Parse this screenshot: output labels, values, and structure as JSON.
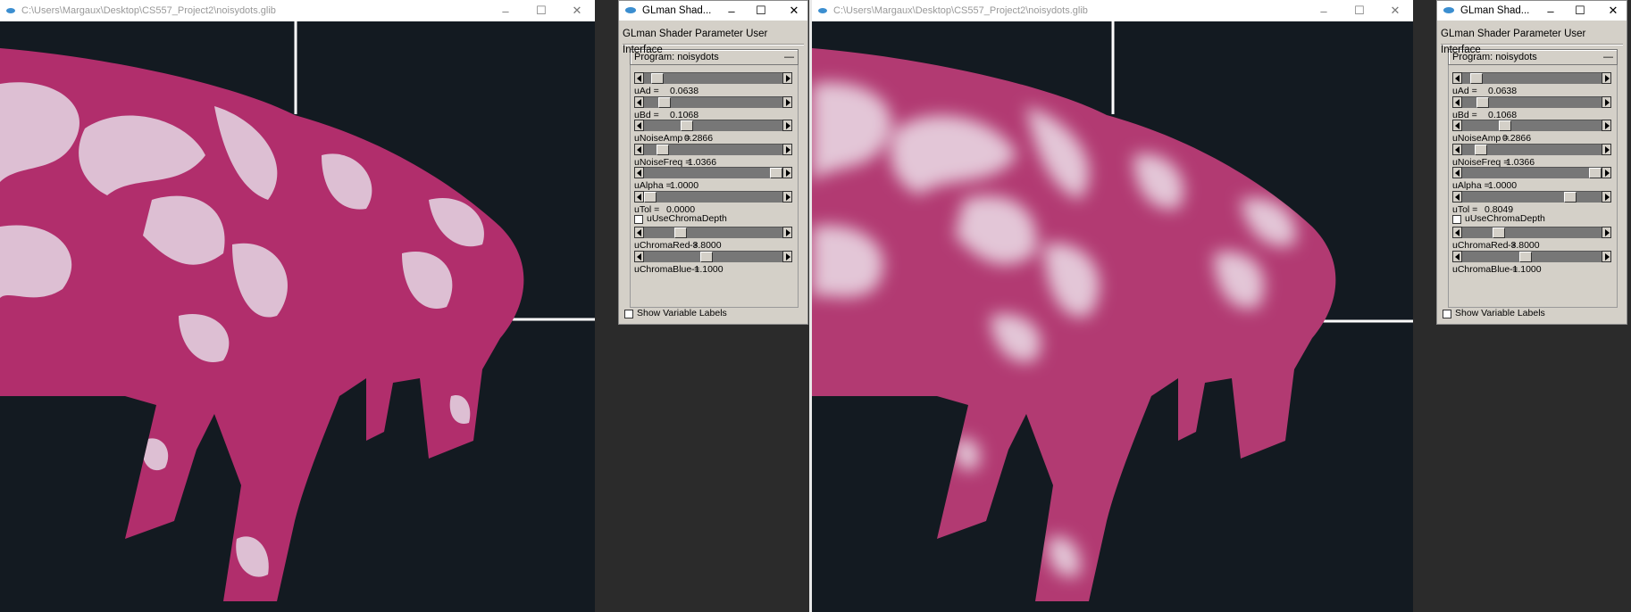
{
  "left": {
    "viewer_title": "C:\\Users\\Margaux\\Desktop\\CS557_Project2\\noisydots.glib",
    "panel_title": "GLman Shad...",
    "panel_header": "GLman Shader Parameter User Interface",
    "program_label": "Program: noisydots",
    "program_toggle": "—",
    "params": [
      {
        "name": "uAd =",
        "value": "0.0638",
        "level": 0.06
      },
      {
        "name": "uBd =",
        "value": "0.1068",
        "level": 0.11
      },
      {
        "name": "uNoiseAmp =",
        "value": "0.2866",
        "level": 0.29
      },
      {
        "name": "uNoiseFreq =",
        "value": "1.0366",
        "level": 0.1
      },
      {
        "name": "uAlpha =",
        "value": "1.0000",
        "level": 1.0
      },
      {
        "name": "uTol =",
        "value": "0.0000",
        "level": 0.0
      }
    ],
    "chroma_label": "uUseChromaDepth",
    "chroma_params": [
      {
        "name": "uChromaRed =",
        "value": "-3.8000",
        "level": 0.24
      },
      {
        "name": "uChromaBlue =",
        "value": "-1.1000",
        "level": 0.45
      }
    ],
    "show_labels": "Show Variable Labels"
  },
  "right": {
    "viewer_title": "C:\\Users\\Margaux\\Desktop\\CS557_Project2\\noisydots.glib",
    "panel_title": "GLman Shad...",
    "panel_header": "GLman Shader Parameter User Interface",
    "program_label": "Program: noisydots",
    "program_toggle": "—",
    "params": [
      {
        "name": "uAd =",
        "value": "0.0638",
        "level": 0.06
      },
      {
        "name": "uBd =",
        "value": "0.1068",
        "level": 0.11
      },
      {
        "name": "uNoiseAmp =",
        "value": "0.2866",
        "level": 0.29
      },
      {
        "name": "uNoiseFreq =",
        "value": "1.0366",
        "level": 0.1
      },
      {
        "name": "uAlpha =",
        "value": "1.0000",
        "level": 1.0
      },
      {
        "name": "uTol =",
        "value": "0.8049",
        "level": 0.8
      }
    ],
    "chroma_label": "uUseChromaDepth",
    "chroma_params": [
      {
        "name": "uChromaRed =",
        "value": "-3.8000",
        "level": 0.24
      },
      {
        "name": "uChromaBlue =",
        "value": "-1.1000",
        "level": 0.45
      }
    ],
    "show_labels": "Show Variable Labels"
  },
  "icons": {
    "minimize": "minimize-icon",
    "maximize": "maximize-icon",
    "close": "close-icon"
  },
  "colors": {
    "pink": "#b12e6c",
    "spot": "#ddbfd3",
    "background": "#131a21"
  }
}
